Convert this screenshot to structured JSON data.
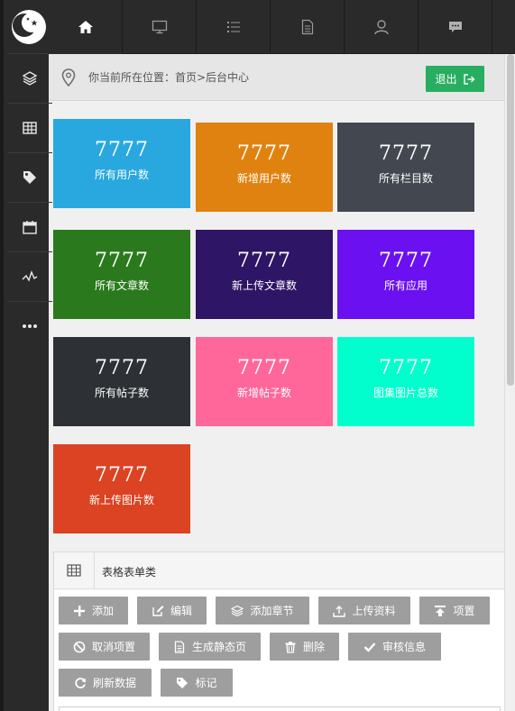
{
  "colors": {
    "rail_bg": "#2a2a2a",
    "accent_green": "#27ae60",
    "button_gray": "#9e9e9e"
  },
  "rail": {
    "logo": "moon-stars-icon",
    "items": [
      {
        "icon": "layers-icon"
      },
      {
        "icon": "table-icon"
      },
      {
        "icon": "tag-icon"
      },
      {
        "icon": "calendar-icon"
      },
      {
        "icon": "activity-icon"
      },
      {
        "icon": "more-icon"
      }
    ]
  },
  "topnav": {
    "tabs": [
      {
        "icon": "home-icon",
        "active": true
      },
      {
        "icon": "monitor-icon"
      },
      {
        "icon": "list-icon"
      },
      {
        "icon": "document-icon"
      },
      {
        "icon": "user-icon"
      },
      {
        "icon": "chat-icon"
      }
    ]
  },
  "breadcrumb": {
    "text": "你当前所在位置：首页>后台中心",
    "logout_label": "退出"
  },
  "tiles": [
    {
      "value": "7777",
      "label": "所有用户数",
      "color": "#29a8e0"
    },
    {
      "value": "7777",
      "label": "新增用户数",
      "color": "#e0820f"
    },
    {
      "value": "7777",
      "label": "所有栏目数",
      "color": "#434850"
    },
    {
      "value": "7777",
      "label": "所有文章数",
      "color": "#2a7a1d"
    },
    {
      "value": "7777",
      "label": "新上传文章数",
      "color": "#2e1566"
    },
    {
      "value": "7777",
      "label": "所有应用",
      "color": "#6b10f0"
    },
    {
      "value": "7777",
      "label": "所有帖子数",
      "color": "#2d3136"
    },
    {
      "value": "7777",
      "label": "新增帖子数",
      "color": "#ff6699"
    },
    {
      "value": "7777",
      "label": "图集图片总数",
      "color": "#00ffcc"
    },
    {
      "value": "7777",
      "label": "新上传图片数",
      "color": "#db4322"
    }
  ],
  "panel": {
    "title": "表格表单类",
    "buttons": [
      {
        "label": "添加",
        "icon": "plus-icon"
      },
      {
        "label": "编辑",
        "icon": "edit-icon"
      },
      {
        "label": "添加章节",
        "icon": "layers-icon"
      },
      {
        "label": "上传资料",
        "icon": "upload-icon"
      },
      {
        "label": "项置",
        "icon": "to-top-icon"
      },
      {
        "label": "取消项置",
        "icon": "ban-icon"
      },
      {
        "label": "生成静态页",
        "icon": "file-icon"
      },
      {
        "label": "删除",
        "icon": "trash-icon"
      },
      {
        "label": "审核信息",
        "icon": "check-icon"
      },
      {
        "label": "刷新数据",
        "icon": "refresh-icon"
      },
      {
        "label": "标记",
        "icon": "tag-icon"
      }
    ]
  }
}
